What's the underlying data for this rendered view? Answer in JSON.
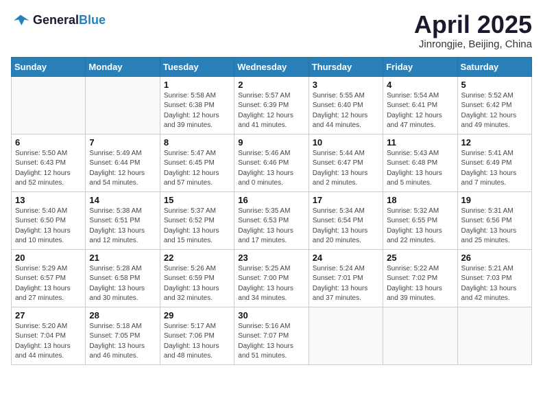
{
  "logo": {
    "general": "General",
    "blue": "Blue"
  },
  "header": {
    "month": "April 2025",
    "location": "Jinrongjie, Beijing, China"
  },
  "weekdays": [
    "Sunday",
    "Monday",
    "Tuesday",
    "Wednesday",
    "Thursday",
    "Friday",
    "Saturday"
  ],
  "weeks": [
    [
      {
        "day": "",
        "info": ""
      },
      {
        "day": "",
        "info": ""
      },
      {
        "day": "1",
        "info": "Sunrise: 5:58 AM\nSunset: 6:38 PM\nDaylight: 12 hours\nand 39 minutes."
      },
      {
        "day": "2",
        "info": "Sunrise: 5:57 AM\nSunset: 6:39 PM\nDaylight: 12 hours\nand 41 minutes."
      },
      {
        "day": "3",
        "info": "Sunrise: 5:55 AM\nSunset: 6:40 PM\nDaylight: 12 hours\nand 44 minutes."
      },
      {
        "day": "4",
        "info": "Sunrise: 5:54 AM\nSunset: 6:41 PM\nDaylight: 12 hours\nand 47 minutes."
      },
      {
        "day": "5",
        "info": "Sunrise: 5:52 AM\nSunset: 6:42 PM\nDaylight: 12 hours\nand 49 minutes."
      }
    ],
    [
      {
        "day": "6",
        "info": "Sunrise: 5:50 AM\nSunset: 6:43 PM\nDaylight: 12 hours\nand 52 minutes."
      },
      {
        "day": "7",
        "info": "Sunrise: 5:49 AM\nSunset: 6:44 PM\nDaylight: 12 hours\nand 54 minutes."
      },
      {
        "day": "8",
        "info": "Sunrise: 5:47 AM\nSunset: 6:45 PM\nDaylight: 12 hours\nand 57 minutes."
      },
      {
        "day": "9",
        "info": "Sunrise: 5:46 AM\nSunset: 6:46 PM\nDaylight: 13 hours\nand 0 minutes."
      },
      {
        "day": "10",
        "info": "Sunrise: 5:44 AM\nSunset: 6:47 PM\nDaylight: 13 hours\nand 2 minutes."
      },
      {
        "day": "11",
        "info": "Sunrise: 5:43 AM\nSunset: 6:48 PM\nDaylight: 13 hours\nand 5 minutes."
      },
      {
        "day": "12",
        "info": "Sunrise: 5:41 AM\nSunset: 6:49 PM\nDaylight: 13 hours\nand 7 minutes."
      }
    ],
    [
      {
        "day": "13",
        "info": "Sunrise: 5:40 AM\nSunset: 6:50 PM\nDaylight: 13 hours\nand 10 minutes."
      },
      {
        "day": "14",
        "info": "Sunrise: 5:38 AM\nSunset: 6:51 PM\nDaylight: 13 hours\nand 12 minutes."
      },
      {
        "day": "15",
        "info": "Sunrise: 5:37 AM\nSunset: 6:52 PM\nDaylight: 13 hours\nand 15 minutes."
      },
      {
        "day": "16",
        "info": "Sunrise: 5:35 AM\nSunset: 6:53 PM\nDaylight: 13 hours\nand 17 minutes."
      },
      {
        "day": "17",
        "info": "Sunrise: 5:34 AM\nSunset: 6:54 PM\nDaylight: 13 hours\nand 20 minutes."
      },
      {
        "day": "18",
        "info": "Sunrise: 5:32 AM\nSunset: 6:55 PM\nDaylight: 13 hours\nand 22 minutes."
      },
      {
        "day": "19",
        "info": "Sunrise: 5:31 AM\nSunset: 6:56 PM\nDaylight: 13 hours\nand 25 minutes."
      }
    ],
    [
      {
        "day": "20",
        "info": "Sunrise: 5:29 AM\nSunset: 6:57 PM\nDaylight: 13 hours\nand 27 minutes."
      },
      {
        "day": "21",
        "info": "Sunrise: 5:28 AM\nSunset: 6:58 PM\nDaylight: 13 hours\nand 30 minutes."
      },
      {
        "day": "22",
        "info": "Sunrise: 5:26 AM\nSunset: 6:59 PM\nDaylight: 13 hours\nand 32 minutes."
      },
      {
        "day": "23",
        "info": "Sunrise: 5:25 AM\nSunset: 7:00 PM\nDaylight: 13 hours\nand 34 minutes."
      },
      {
        "day": "24",
        "info": "Sunrise: 5:24 AM\nSunset: 7:01 PM\nDaylight: 13 hours\nand 37 minutes."
      },
      {
        "day": "25",
        "info": "Sunrise: 5:22 AM\nSunset: 7:02 PM\nDaylight: 13 hours\nand 39 minutes."
      },
      {
        "day": "26",
        "info": "Sunrise: 5:21 AM\nSunset: 7:03 PM\nDaylight: 13 hours\nand 42 minutes."
      }
    ],
    [
      {
        "day": "27",
        "info": "Sunrise: 5:20 AM\nSunset: 7:04 PM\nDaylight: 13 hours\nand 44 minutes."
      },
      {
        "day": "28",
        "info": "Sunrise: 5:18 AM\nSunset: 7:05 PM\nDaylight: 13 hours\nand 46 minutes."
      },
      {
        "day": "29",
        "info": "Sunrise: 5:17 AM\nSunset: 7:06 PM\nDaylight: 13 hours\nand 48 minutes."
      },
      {
        "day": "30",
        "info": "Sunrise: 5:16 AM\nSunset: 7:07 PM\nDaylight: 13 hours\nand 51 minutes."
      },
      {
        "day": "",
        "info": ""
      },
      {
        "day": "",
        "info": ""
      },
      {
        "day": "",
        "info": ""
      }
    ]
  ]
}
